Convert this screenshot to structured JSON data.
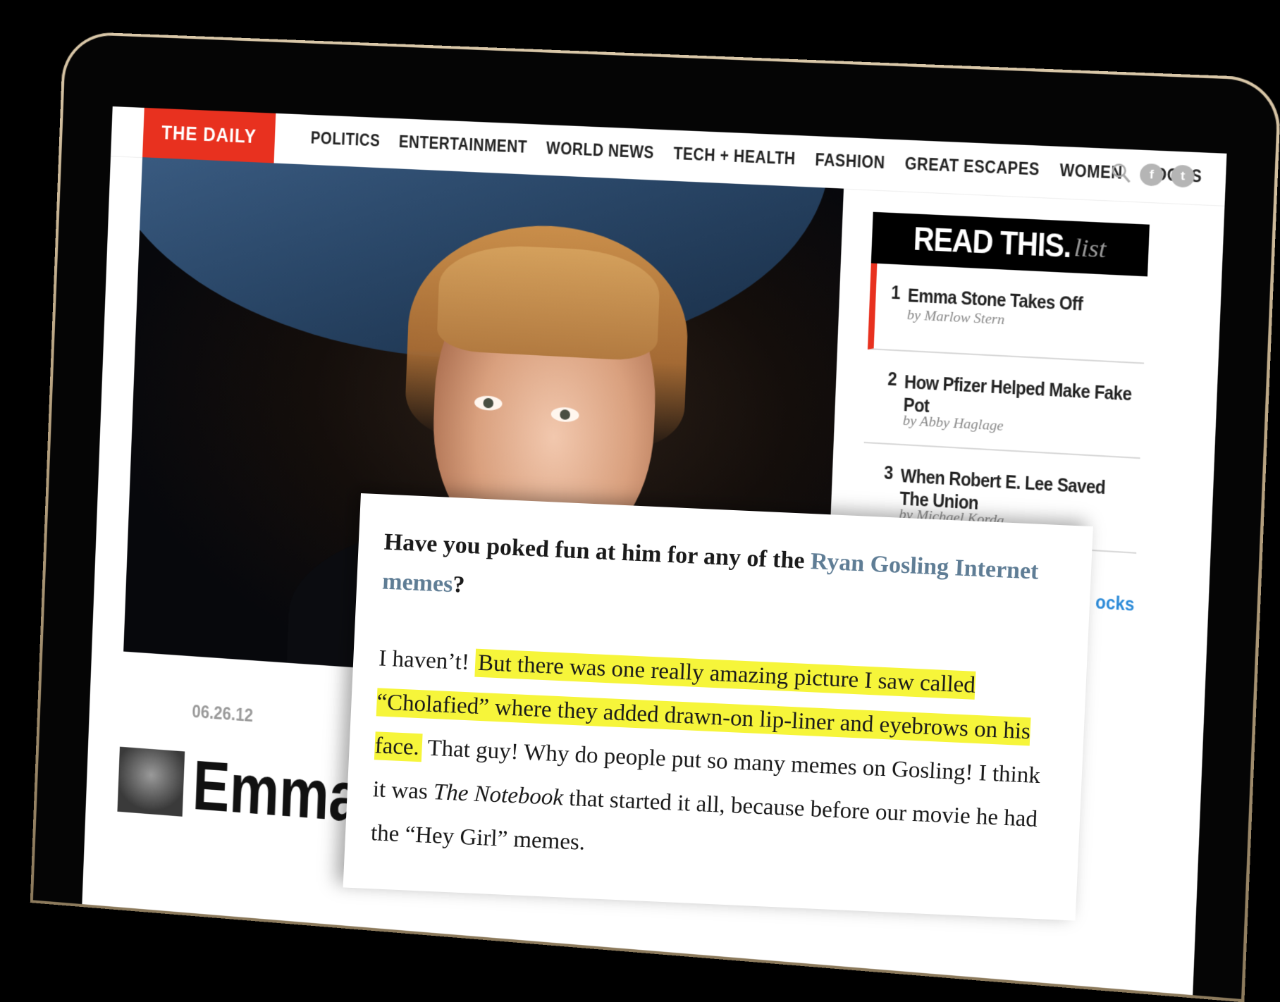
{
  "site": {
    "logo": "THE DAILY BEAST",
    "nav": [
      "POLITICS",
      "ENTERTAINMENT",
      "WORLD NEWS",
      "TECH + HEALTH",
      "FASHION",
      "GREAT ESCAPES",
      "WOMEN",
      "BOOKS"
    ],
    "icons": [
      "search-icon",
      "facebook-icon",
      "twitter-icon"
    ],
    "accent": "#e8311f"
  },
  "article": {
    "date": "06.26.12",
    "headline": "Emma St"
  },
  "read_this": {
    "title_strong": "READ THIS.",
    "title_list": "list",
    "items": [
      {
        "num": "1",
        "title": "Emma Stone Takes Off",
        "by": "by Marlow Stern"
      },
      {
        "num": "2",
        "title": "How Pfizer Helped Make Fake Pot",
        "by": "by Abby Haglage"
      },
      {
        "num": "3",
        "title": "When Robert E. Lee Saved The Union",
        "by": "by Michael Korda"
      }
    ],
    "partial_link": "ocks"
  },
  "zoom": {
    "question_before": "Have you poked fun at him for any of the ",
    "question_link": "Ryan Gosling Internet memes",
    "question_after": "?",
    "answer_plain_1": "I haven’t! ",
    "answer_highlight": "But there was one really amazing picture I saw called “Cholafied” where they added drawn-on lip-liner and eyebrows on his face.",
    "answer_plain_2": " That guy! Why do people put so many memes on Gosling! I think it was ",
    "answer_italic": "The Notebook",
    "answer_plain_3": " that started it all, because before our movie he had the “Hey Girl” memes."
  }
}
